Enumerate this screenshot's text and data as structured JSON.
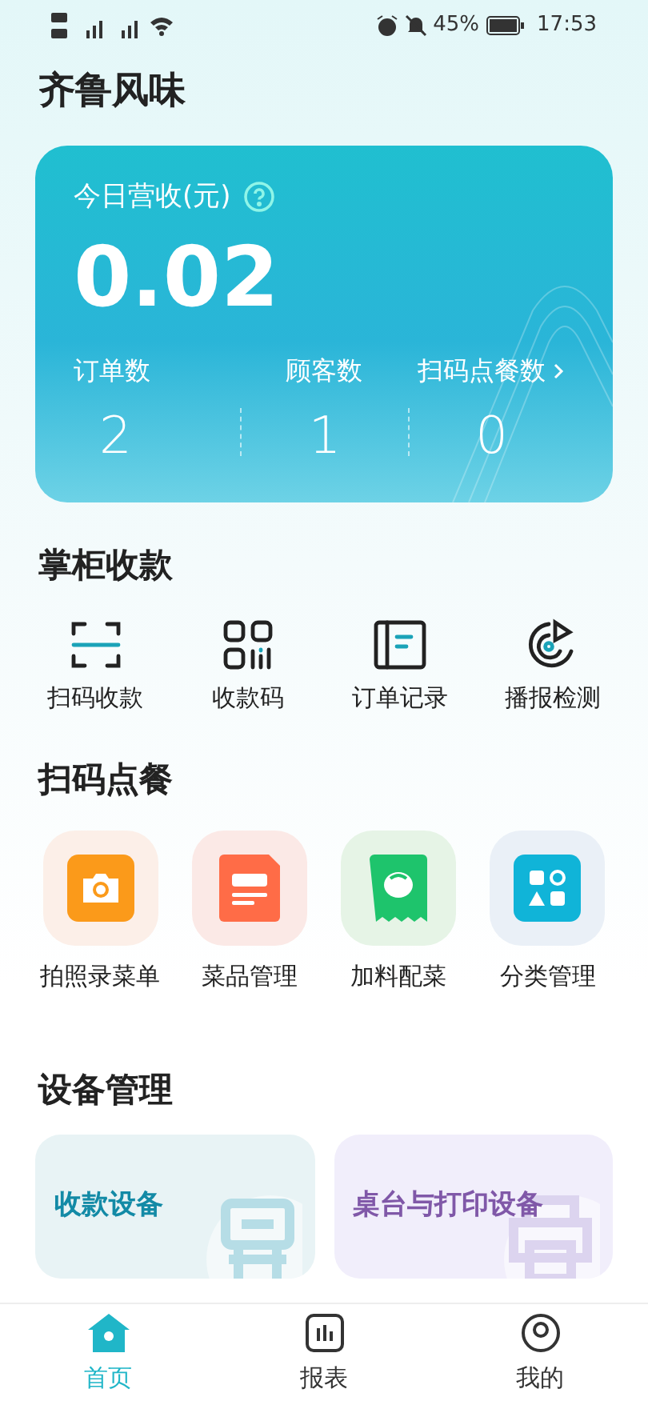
{
  "status_bar": {
    "battery_percent": "45%",
    "time": "17:53"
  },
  "store_name": "齐鲁风味",
  "revenue_card": {
    "label": "今日营收(元)",
    "amount": "0.02",
    "stats": [
      {
        "label": "订单数",
        "value": "2",
        "link": false
      },
      {
        "label": "顾客数",
        "value": "1",
        "link": false
      },
      {
        "label": "扫码点餐数",
        "value": "0",
        "link": true
      }
    ]
  },
  "cashier_section": {
    "title": "掌柜收款",
    "items": [
      {
        "kind": "scan",
        "label": "扫码收款"
      },
      {
        "kind": "qrcode",
        "label": "收款码"
      },
      {
        "kind": "record",
        "label": "订单记录"
      },
      {
        "kind": "broadcast",
        "label": "播报检测"
      }
    ]
  },
  "ordering_section": {
    "title": "扫码点餐",
    "items": [
      {
        "kind": "camera",
        "label": "拍照录菜单"
      },
      {
        "kind": "menu",
        "label": "菜品管理"
      },
      {
        "kind": "addon",
        "label": "加料配菜"
      },
      {
        "kind": "category",
        "label": "分类管理"
      }
    ]
  },
  "device_section": {
    "title": "设备管理",
    "cards": [
      {
        "kind": "payment",
        "label": "收款设备"
      },
      {
        "kind": "printer",
        "label": "桌台与打印设备"
      }
    ]
  },
  "bottom_nav": [
    {
      "kind": "home",
      "label": "首页",
      "selected": true
    },
    {
      "kind": "report",
      "label": "报表",
      "selected": false
    },
    {
      "kind": "profile",
      "label": "我的",
      "selected": false
    }
  ]
}
